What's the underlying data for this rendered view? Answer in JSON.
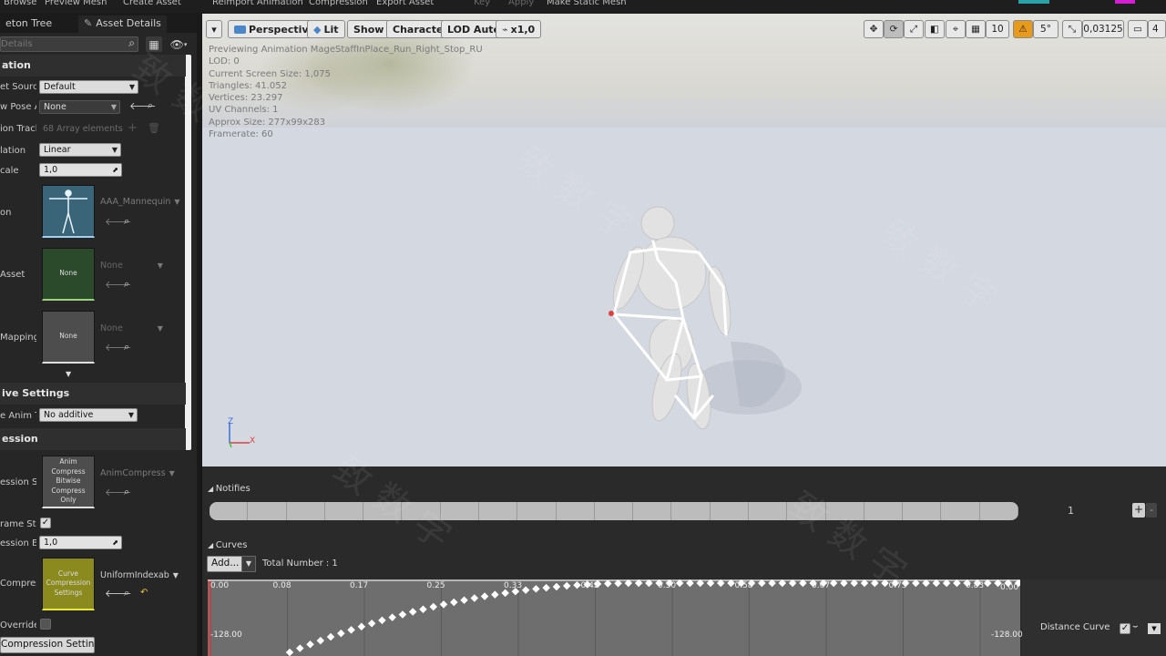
{
  "topbar": {
    "left_items": [
      "Browse",
      "Preview Mesh",
      "Create Asset"
    ],
    "right_items": [
      "Reimport Animation",
      "Compression",
      "Export Asset"
    ],
    "dim_items": [
      "Key",
      "Apply"
    ],
    "extra_item": "Make Static Mesh"
  },
  "tabs": {
    "skeleton_tree": "eton Tree",
    "asset_details": "Asset Details"
  },
  "search": {
    "placeholder": "Details"
  },
  "sections": {
    "animation": "ation",
    "additive": "ive Settings",
    "compression": "ession"
  },
  "props": {
    "retarget_source": {
      "label": "et Source",
      "value": "Default"
    },
    "preview_pose": {
      "label": "w Pose A",
      "value": "None"
    },
    "animation_track": {
      "label": "ion Track",
      "value": "68 Array elements"
    },
    "interpolation": {
      "label": "lation",
      "value": "Linear"
    },
    "rate_scale": {
      "label": "cale",
      "value": "1,0"
    },
    "skeleton": {
      "label": "on",
      "asset": "AAA_Mannequin"
    },
    "parent_asset": {
      "label": "Asset",
      "asset": "None",
      "thumb": "None"
    },
    "asset_mapping": {
      "label": "Mapping T",
      "asset": "None",
      "thumb": "None"
    },
    "additive_anim_type": {
      "label": "e Anim T",
      "value": "No additive"
    },
    "compression_scheme": {
      "label": "ession Sc",
      "asset": "AnimCompress",
      "thumb": "Anim Compress Bitwise Compress Only"
    },
    "allow_frame_stripping": {
      "label": "rame Str",
      "checked": true
    },
    "compression_error": {
      "label": "ession Err",
      "value": "1,0"
    },
    "curve_compression": {
      "label": "Compress",
      "asset": "UniformIndexab",
      "thumb": "Curve Compression Settings"
    },
    "override": {
      "label": "Override",
      "checked": false
    },
    "compression_settings_button": "Compression Settings"
  },
  "viewport": {
    "menu_glyph": "▾",
    "perspective": "Perspective",
    "lit": "Lit",
    "show": "Show",
    "character": "Character",
    "lod": "LOD Auto",
    "speed": "x1,0",
    "stats": [
      "Previewing Animation MageStaffInPlace_Run_Right_Stop_RU",
      "LOD: 0",
      "Current Screen Size: 1,075",
      "Triangles: 41.052",
      "Vertices: 23.297",
      "UV Channels: 1",
      "Approx Size: 277x99x283",
      "Framerate: 60"
    ],
    "grid_snap": "10",
    "angle_snap": "5°",
    "scale_snap": "0,03125",
    "camera_speed": "4",
    "axis_z": "Z",
    "axis_x": "X"
  },
  "notifies": {
    "title": "Notifies",
    "track_count": "1",
    "plus": "+",
    "minus": "-"
  },
  "curves": {
    "title": "Curves",
    "add_label": "Add...",
    "total": "Total Number : 1",
    "x_ticks": [
      "0.00",
      "0.08",
      "0.17",
      "0.25",
      "0.33",
      "0.42",
      "0.50",
      "0.58",
      "0.67",
      "0.75",
      "0.83"
    ],
    "y_top": "0.00",
    "y_top_right": "0.00",
    "y_bottom": "-128.00",
    "y_bottom_right": "-128.00",
    "curve_name": "Distance Curve"
  },
  "colors": {
    "orange": "#e89a1a",
    "blue": "#4a86c8",
    "teal": "#2aa3a8",
    "magenta": "#d21fd2"
  }
}
